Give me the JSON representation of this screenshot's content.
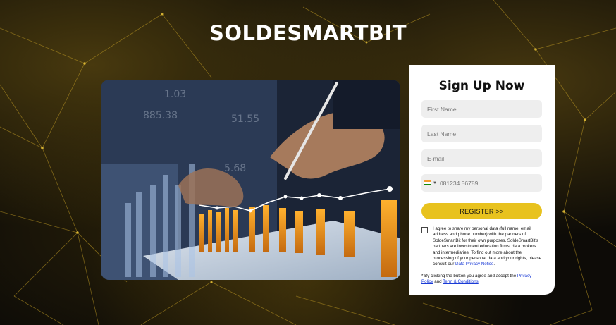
{
  "brand": {
    "title": "SOLDESMARTBIT"
  },
  "form": {
    "title": "Sign Up Now",
    "first_name_placeholder": "First Name",
    "last_name_placeholder": "Last Name",
    "email_placeholder": "E-mail",
    "phone_placeholder": "081234 56789",
    "country_flag_icon": "india-flag-icon",
    "register_label": "REGISTER >>",
    "consent_text": "I agree to share my personal data (full name, email address and phone number) with the partners of SoldeSmartBit for their own purposes. SoldeSmartBit's partners are investment education firms, data brokers and intermediaries. To find out more about the processing of your personal data and your rights, please consult our",
    "consent_link": "Data Privacy Notice",
    "consent_end": ".",
    "note_prefix": "* By clicking the button you agree and accept the",
    "privacy_link": "Privacy Policy",
    "note_and": "and",
    "terms_link": "Term & Conditions"
  },
  "colors": {
    "accent": "#e8c21e",
    "background": "#0d0b07",
    "link": "#1a3bd6"
  }
}
